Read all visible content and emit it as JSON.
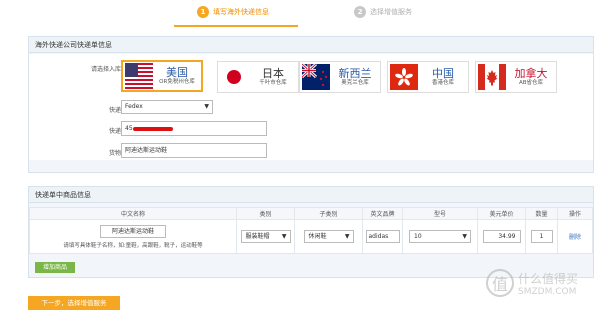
{
  "steps": [
    {
      "num": "1",
      "label": "填写海外快递信息"
    },
    {
      "num": "2",
      "label": "选择增值服务"
    }
  ],
  "panel1": {
    "title": "海外快递公司快递单信息",
    "warehouse_label": "请选择入库仓库",
    "warehouses": [
      {
        "name": "美国",
        "sub": "OR免税州仓库",
        "flag": "usa-flag-icon"
      },
      {
        "name": "日本",
        "sub": "千叶市仓库",
        "flag": "japan-flag-icon"
      },
      {
        "name": "新西兰",
        "sub": "奥克兰仓库",
        "flag": "new-zealand-flag-icon"
      },
      {
        "name": "中国",
        "sub": "香港仓库",
        "flag": "hong-kong-flag-icon"
      },
      {
        "name": "加拿大",
        "sub": "AB省仓库",
        "flag": "canada-flag-icon"
      }
    ],
    "courier_label": "快递公司",
    "courier_value": "Fedex",
    "tracking_label": "快递编号",
    "tracking_value": "45",
    "goods_label": "货物概述",
    "goods_value": "阿迪达斯运动鞋"
  },
  "panel2": {
    "title": "快递单中商品信息",
    "columns": [
      "中文名称",
      "类别",
      "子类别",
      "英文品牌",
      "型号",
      "美元单价",
      "数量",
      "操作"
    ],
    "row": {
      "name": "阿迪达斯运动鞋",
      "hint": "请填写具体鞋子名称，如:童鞋，高跟鞋，靴子，运动鞋等",
      "category": "服装鞋帽",
      "subcategory": "休闲鞋",
      "brand": "adidas",
      "model": "10",
      "price": "34.99",
      "qty": "1",
      "action": "删除"
    },
    "add_label": "增加商品"
  },
  "next_label": "下一步，选择增值服务",
  "watermark": {
    "t1": "什么值得买",
    "t2": "SMZDM.COM"
  },
  "colors": {
    "accent": "#f5a623",
    "green": "#7ab648",
    "link": "#3a77c4"
  }
}
